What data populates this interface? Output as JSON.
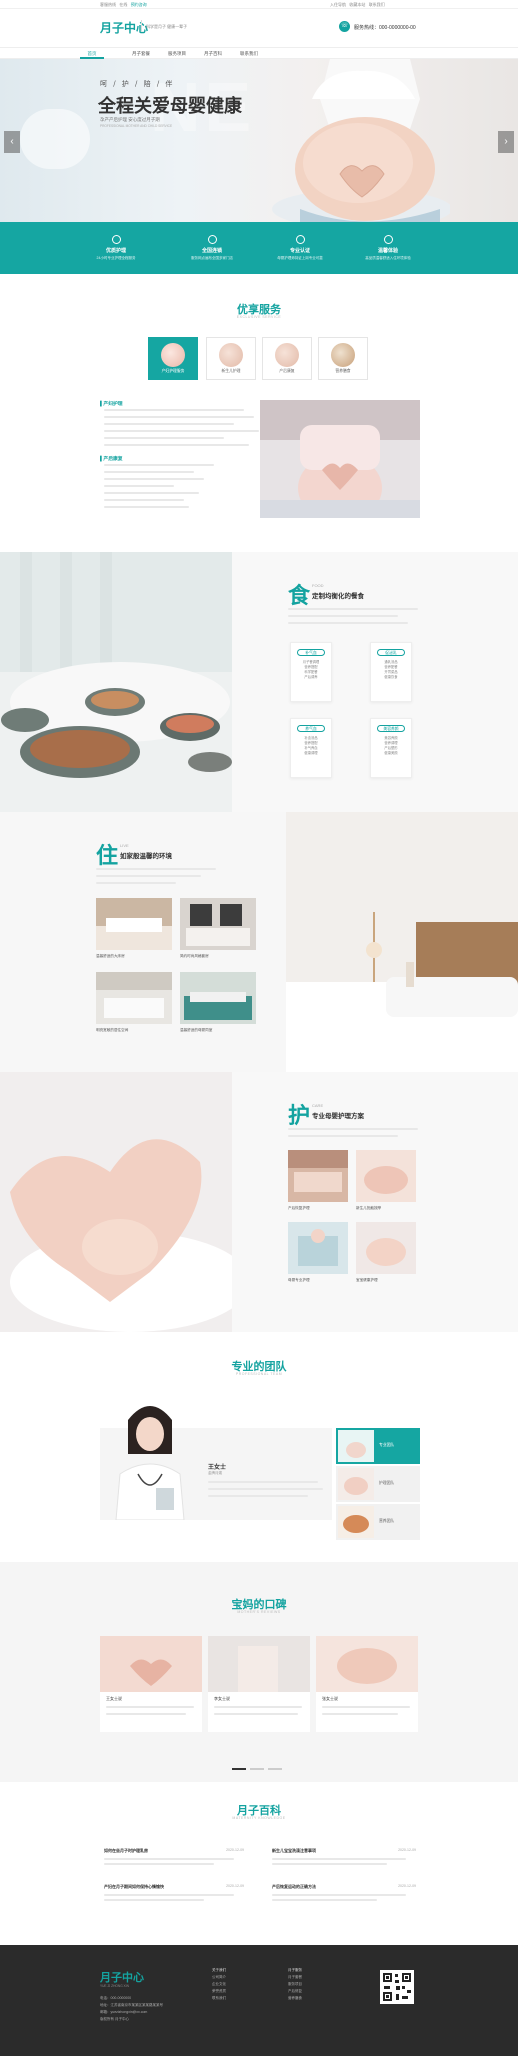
{
  "topbar": {
    "left": [
      "客服热线",
      "在线",
      "预约咨询"
    ],
    "right": [
      "入住导航",
      "收藏本站",
      "联系我们"
    ]
  },
  "header": {
    "logo": "月子中心",
    "slogan": "科学是月子 健康一辈子",
    "phone_label": "服务热线：000-0000000-00"
  },
  "nav": [
    "首页",
    "月子套餐",
    "服务项目",
    "月子百科",
    "联系我们"
  ],
  "hero": {
    "small_title": "呵 / 护 / 陪 / 伴",
    "title": "全程关爱母婴健康",
    "line1": "孕产产后护理 安心度过月子期",
    "line2": "PROFESSIONAL MOTHER AND CHILD SERVICE"
  },
  "features": [
    {
      "title": "优质护理",
      "desc": "24小时专业护理全程服务"
    },
    {
      "title": "全国连锁",
      "desc": "服务网点遍布全国多家门店"
    },
    {
      "title": "专业认证",
      "desc": "母婴护理师持证上岗专业可靠"
    },
    {
      "title": "温馨体验",
      "desc": "高品质温馨舒适入住环境体验"
    }
  ],
  "services": {
    "title": "优享服务",
    "subtitle": "EXCLUSIVE SERVICE",
    "tabs": [
      "产妇护理服务",
      "新生儿护理",
      "产后康复",
      "营养膳食"
    ],
    "heading1": "产妇护理",
    "heading2": "产后康复"
  },
  "food": {
    "char": "食",
    "en": "FOOD",
    "heading": "定制均衡化的餐食",
    "cats": [
      {
        "name": "补气血",
        "items": [
          "月子餐调理",
          "营养搭配",
          "科学配餐",
          "产后调养"
        ]
      },
      {
        "name": "促泌乳",
        "items": [
          "通乳汤品",
          "营养配餐",
          "开胃菜品",
          "健康饮食"
        ]
      },
      {
        "name": "养气血",
        "items": [
          "补血汤品",
          "营养搭配",
          "补气养血",
          "健康调理"
        ]
      },
      {
        "name": "美容养颜",
        "items": [
          "美容养颜",
          "营养调理",
          "产后塑形",
          "健康美颜"
        ]
      }
    ]
  },
  "living": {
    "char": "住",
    "en": "LIVE",
    "heading": "如家般温馨的环境",
    "captions": [
      "温馨舒适的大床房",
      "简约时尚风格套房",
      "明亮宽敞的居住空间",
      "温馨舒适的母婴同室"
    ]
  },
  "care": {
    "char": "护",
    "en": "CARE",
    "heading": "专业母婴护理方案",
    "captions": [
      "产后恢复护理",
      "新生儿抚触按摩",
      "母婴专业护理",
      "宝宝健康护理"
    ]
  },
  "team": {
    "title": "专业的团队",
    "subtitle": "PROFESSIONAL TEAM",
    "name": "王女士",
    "role": "金牌月嫂",
    "tabs": [
      "专业团队",
      "护理团队",
      "营养团队"
    ]
  },
  "reviews": {
    "title": "宝妈的口碑",
    "subtitle": "MOTHER'S REVIEWS",
    "items": [
      {
        "name": "王女士说"
      },
      {
        "name": "李女士说"
      },
      {
        "name": "张女士说"
      }
    ]
  },
  "encyclopedia": {
    "title": "月子百科",
    "subtitle": "MATERNITY KNOWLEDGE",
    "left": [
      {
        "title": "如何在坐月子时护理乳房",
        "date": "2020-12-09"
      },
      {
        "title": "产妇在月子期间如何保持心情愉快",
        "date": "2020-12-09"
      }
    ],
    "right": [
      {
        "title": "新生儿宝宝洗澡注意事项",
        "date": "2020-12-09"
      },
      {
        "title": "产后恢复运动的正确方法",
        "date": "2020-12-09"
      }
    ]
  },
  "footer": {
    "logo": "月子中心",
    "logo_en": "YUE ZI ZHONG XIN",
    "lines": [
      "电话：000-0000000",
      "地址：江苏省南京市某某区某某路某某号",
      "邮箱：yuezizhongxin@xx.com",
      "版权所有 月子中心"
    ],
    "col1_title": "关于我们",
    "col1": [
      "公司简介",
      "企业文化",
      "荣誉资质",
      "联系我们"
    ],
    "col2_title": "月子服务",
    "col2": [
      "月子套餐",
      "服务项目",
      "产后修复",
      "营养膳食"
    ]
  }
}
